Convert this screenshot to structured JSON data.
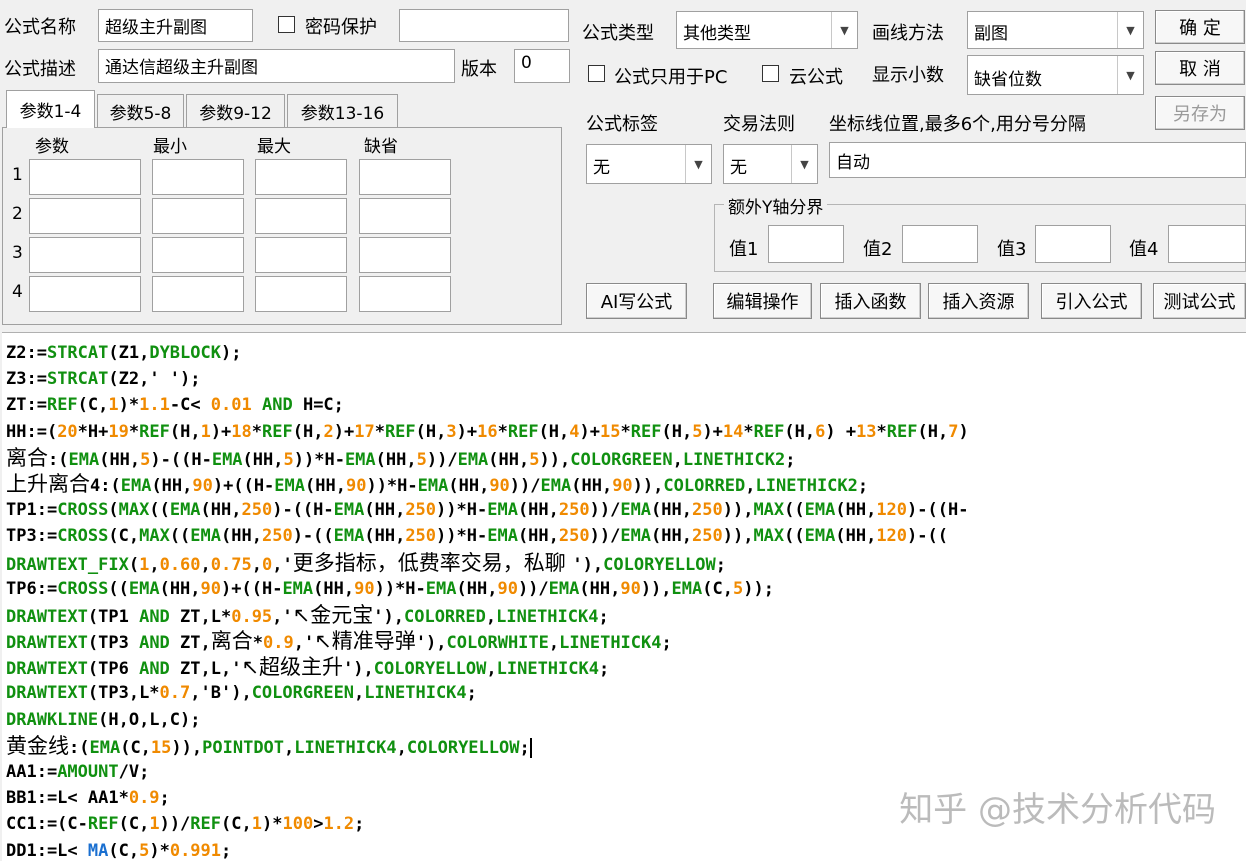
{
  "header": {
    "formula_name_label": "公式名称",
    "formula_name_value": "超级主升副图",
    "password_label": "密码保护",
    "password_value": "",
    "formula_desc_label": "公式描述",
    "formula_desc_value": "通达信超级主升副图",
    "version_label": "版本",
    "version_value": "0",
    "formula_type_label": "公式类型",
    "formula_type_value": "其他类型",
    "draw_method_label": "画线方法",
    "draw_method_value": "副图",
    "pc_only_label": "公式只用于PC",
    "cloud_label": "云公式",
    "decimals_label": "显示小数",
    "decimals_value": "缺省位数",
    "formula_tag_label": "公式标签",
    "formula_tag_value": "无",
    "trade_rule_label": "交易法则",
    "trade_rule_value": "无",
    "axis_label": "坐标线位置,最多6个,用分号分隔",
    "axis_value": "自动",
    "extra_y_label": "额外Y轴分界",
    "y1_label": "值1",
    "y2_label": "值2",
    "y3_label": "值3",
    "y4_label": "值4"
  },
  "buttons": {
    "ok": "确 定",
    "cancel": "取 消",
    "save_as": "另存为",
    "ai": "AI写公式",
    "edit": "编辑操作",
    "insert_func": "插入函数",
    "insert_res": "插入资源",
    "import": "引入公式",
    "test": "测试公式"
  },
  "tabs": [
    "参数1-4",
    "参数5-8",
    "参数9-12",
    "参数13-16"
  ],
  "params": {
    "headers": [
      "参数",
      "最小",
      "最大",
      "缺省"
    ],
    "rows": [
      "1",
      "2",
      "3",
      "4"
    ]
  },
  "code_lines": [
    [
      [
        "k",
        "Z2:="
      ],
      [
        "f",
        "STRCAT"
      ],
      [
        "k",
        "(Z1,"
      ],
      [
        "f",
        "DYBLOCK"
      ],
      [
        "k",
        ");"
      ]
    ],
    [
      [
        "k",
        "Z3:="
      ],
      [
        "f",
        "STRCAT"
      ],
      [
        "k",
        "(Z2,' ');"
      ]
    ],
    [
      [
        "k",
        "ZT:="
      ],
      [
        "f",
        "REF"
      ],
      [
        "k",
        "(C,"
      ],
      [
        "n",
        "1"
      ],
      [
        "k",
        ")*"
      ],
      [
        "n",
        "1.1"
      ],
      [
        "k",
        "-C< "
      ],
      [
        "n",
        "0.01"
      ],
      [
        "k",
        " "
      ],
      [
        "f",
        "AND"
      ],
      [
        "k",
        " H=C;"
      ]
    ],
    [
      [
        "k",
        "HH:=("
      ],
      [
        "n",
        "20"
      ],
      [
        "k",
        "*H+"
      ],
      [
        "n",
        "19"
      ],
      [
        "k",
        "*"
      ],
      [
        "f",
        "REF"
      ],
      [
        "k",
        "(H,"
      ],
      [
        "n",
        "1"
      ],
      [
        "k",
        ")+"
      ],
      [
        "n",
        "18"
      ],
      [
        "k",
        "*"
      ],
      [
        "f",
        "REF"
      ],
      [
        "k",
        "(H,"
      ],
      [
        "n",
        "2"
      ],
      [
        "k",
        ")+"
      ],
      [
        "n",
        "17"
      ],
      [
        "k",
        "*"
      ],
      [
        "f",
        "REF"
      ],
      [
        "k",
        "(H,"
      ],
      [
        "n",
        "3"
      ],
      [
        "k",
        ")+"
      ],
      [
        "n",
        "16"
      ],
      [
        "k",
        "*"
      ],
      [
        "f",
        "REF"
      ],
      [
        "k",
        "(H,"
      ],
      [
        "n",
        "4"
      ],
      [
        "k",
        ")+"
      ],
      [
        "n",
        "15"
      ],
      [
        "k",
        "*"
      ],
      [
        "f",
        "REF"
      ],
      [
        "k",
        "(H,"
      ],
      [
        "n",
        "5"
      ],
      [
        "k",
        ")+"
      ],
      [
        "n",
        "14"
      ],
      [
        "k",
        "*"
      ],
      [
        "f",
        "REF"
      ],
      [
        "k",
        "(H,"
      ],
      [
        "n",
        "6"
      ],
      [
        "k",
        ") +"
      ],
      [
        "n",
        "13"
      ],
      [
        "k",
        "*"
      ],
      [
        "f",
        "REF"
      ],
      [
        "k",
        "(H,"
      ],
      [
        "n",
        "7"
      ],
      [
        "k",
        ")"
      ]
    ],
    [
      [
        "c",
        "离合"
      ],
      [
        "k",
        ":("
      ],
      [
        "f",
        "EMA"
      ],
      [
        "k",
        "(HH,"
      ],
      [
        "n",
        "5"
      ],
      [
        "k",
        ")-((H-"
      ],
      [
        "f",
        "EMA"
      ],
      [
        "k",
        "(HH,"
      ],
      [
        "n",
        "5"
      ],
      [
        "k",
        "))*H-"
      ],
      [
        "f",
        "EMA"
      ],
      [
        "k",
        "(HH,"
      ],
      [
        "n",
        "5"
      ],
      [
        "k",
        "))/"
      ],
      [
        "f",
        "EMA"
      ],
      [
        "k",
        "(HH,"
      ],
      [
        "n",
        "5"
      ],
      [
        "k",
        ")),"
      ],
      [
        "f",
        "COLORGREEN"
      ],
      [
        "k",
        ","
      ],
      [
        "f",
        "LINETHICK2"
      ],
      [
        "k",
        ";"
      ]
    ],
    [
      [
        "c",
        "上升离合"
      ],
      [
        "k",
        "4:("
      ],
      [
        "f",
        "EMA"
      ],
      [
        "k",
        "(HH,"
      ],
      [
        "n",
        "90"
      ],
      [
        "k",
        ")+((H-"
      ],
      [
        "f",
        "EMA"
      ],
      [
        "k",
        "(HH,"
      ],
      [
        "n",
        "90"
      ],
      [
        "k",
        "))*H-"
      ],
      [
        "f",
        "EMA"
      ],
      [
        "k",
        "(HH,"
      ],
      [
        "n",
        "90"
      ],
      [
        "k",
        "))/"
      ],
      [
        "f",
        "EMA"
      ],
      [
        "k",
        "(HH,"
      ],
      [
        "n",
        "90"
      ],
      [
        "k",
        ")),"
      ],
      [
        "f",
        "COLORRED"
      ],
      [
        "k",
        ","
      ],
      [
        "f",
        "LINETHICK2"
      ],
      [
        "k",
        ";"
      ]
    ],
    [
      [
        "k",
        "TP1:="
      ],
      [
        "f",
        "CROSS"
      ],
      [
        "k",
        "("
      ],
      [
        "f",
        "MAX"
      ],
      [
        "k",
        "(("
      ],
      [
        "f",
        "EMA"
      ],
      [
        "k",
        "(HH,"
      ],
      [
        "n",
        "250"
      ],
      [
        "k",
        ")-((H-"
      ],
      [
        "f",
        "EMA"
      ],
      [
        "k",
        "(HH,"
      ],
      [
        "n",
        "250"
      ],
      [
        "k",
        "))*H-"
      ],
      [
        "f",
        "EMA"
      ],
      [
        "k",
        "(HH,"
      ],
      [
        "n",
        "250"
      ],
      [
        "k",
        "))/"
      ],
      [
        "f",
        "EMA"
      ],
      [
        "k",
        "(HH,"
      ],
      [
        "n",
        "250"
      ],
      [
        "k",
        ")),"
      ],
      [
        "f",
        "MAX"
      ],
      [
        "k",
        "(("
      ],
      [
        "f",
        "EMA"
      ],
      [
        "k",
        "(HH,"
      ],
      [
        "n",
        "120"
      ],
      [
        "k",
        ")-((H-"
      ]
    ],
    [
      [
        "k",
        "TP3:="
      ],
      [
        "f",
        "CROSS"
      ],
      [
        "k",
        "(C,"
      ],
      [
        "f",
        "MAX"
      ],
      [
        "k",
        "(("
      ],
      [
        "f",
        "EMA"
      ],
      [
        "k",
        "(HH,"
      ],
      [
        "n",
        "250"
      ],
      [
        "k",
        ")-(("
      ],
      [
        "f",
        "EMA"
      ],
      [
        "k",
        "(HH,"
      ],
      [
        "n",
        "250"
      ],
      [
        "k",
        "))*H-"
      ],
      [
        "f",
        "EMA"
      ],
      [
        "k",
        "(HH,"
      ],
      [
        "n",
        "250"
      ],
      [
        "k",
        "))/"
      ],
      [
        "f",
        "EMA"
      ],
      [
        "k",
        "(HH,"
      ],
      [
        "n",
        "250"
      ],
      [
        "k",
        ")),"
      ],
      [
        "f",
        "MAX"
      ],
      [
        "k",
        "(("
      ],
      [
        "f",
        "EMA"
      ],
      [
        "k",
        "(HH,"
      ],
      [
        "n",
        "120"
      ],
      [
        "k",
        ")-(("
      ]
    ],
    [
      [
        "f",
        "DRAWTEXT_FIX"
      ],
      [
        "k",
        "("
      ],
      [
        "n",
        "1"
      ],
      [
        "k",
        ","
      ],
      [
        "n",
        "0.60"
      ],
      [
        "k",
        ","
      ],
      [
        "n",
        "0.75"
      ],
      [
        "k",
        ","
      ],
      [
        "n",
        "0"
      ],
      [
        "k",
        ",'"
      ],
      [
        "c",
        "更多指标，低费率交易，私聊 "
      ],
      [
        "k",
        "'),"
      ],
      [
        "f",
        "COLORYELLOW"
      ],
      [
        "k",
        ";"
      ]
    ],
    [
      [
        "k",
        "TP6:="
      ],
      [
        "f",
        "CROSS"
      ],
      [
        "k",
        "(("
      ],
      [
        "f",
        "EMA"
      ],
      [
        "k",
        "(HH,"
      ],
      [
        "n",
        "90"
      ],
      [
        "k",
        ")+((H-"
      ],
      [
        "f",
        "EMA"
      ],
      [
        "k",
        "(HH,"
      ],
      [
        "n",
        "90"
      ],
      [
        "k",
        "))*H-"
      ],
      [
        "f",
        "EMA"
      ],
      [
        "k",
        "(HH,"
      ],
      [
        "n",
        "90"
      ],
      [
        "k",
        "))/"
      ],
      [
        "f",
        "EMA"
      ],
      [
        "k",
        "(HH,"
      ],
      [
        "n",
        "90"
      ],
      [
        "k",
        ")),"
      ],
      [
        "f",
        "EMA"
      ],
      [
        "k",
        "(C,"
      ],
      [
        "n",
        "5"
      ],
      [
        "k",
        "));"
      ]
    ],
    [
      [
        "f",
        "DRAWTEXT"
      ],
      [
        "k",
        "(TP1 "
      ],
      [
        "f",
        "AND"
      ],
      [
        "k",
        " ZT,L*"
      ],
      [
        "n",
        "0.95"
      ],
      [
        "k",
        ",'"
      ],
      [
        "c",
        "↖金元宝"
      ],
      [
        "k",
        "'),"
      ],
      [
        "f",
        "COLORRED"
      ],
      [
        "k",
        ","
      ],
      [
        "f",
        "LINETHICK4"
      ],
      [
        "k",
        ";"
      ]
    ],
    [
      [
        "f",
        "DRAWTEXT"
      ],
      [
        "k",
        "(TP3 "
      ],
      [
        "f",
        "AND"
      ],
      [
        "k",
        " ZT,"
      ],
      [
        "c",
        "离合"
      ],
      [
        "k",
        "*"
      ],
      [
        "n",
        "0.9"
      ],
      [
        "k",
        ",'"
      ],
      [
        "c",
        "↖精准导弹"
      ],
      [
        "k",
        "'),"
      ],
      [
        "f",
        "COLORWHITE"
      ],
      [
        "k",
        ","
      ],
      [
        "f",
        "LINETHICK4"
      ],
      [
        "k",
        ";"
      ]
    ],
    [
      [
        "f",
        "DRAWTEXT"
      ],
      [
        "k",
        "(TP6 "
      ],
      [
        "f",
        "AND"
      ],
      [
        "k",
        " ZT,L,'"
      ],
      [
        "c",
        "↖超级主升"
      ],
      [
        "k",
        "'),"
      ],
      [
        "f",
        "COLORYELLOW"
      ],
      [
        "k",
        ","
      ],
      [
        "f",
        "LINETHICK4"
      ],
      [
        "k",
        ";"
      ]
    ],
    [
      [
        "f",
        "DRAWTEXT"
      ],
      [
        "k",
        "(TP3,L*"
      ],
      [
        "n",
        "0.7"
      ],
      [
        "k",
        ",'B'),"
      ],
      [
        "f",
        "COLORGREEN"
      ],
      [
        "k",
        ","
      ],
      [
        "f",
        "LINETHICK4"
      ],
      [
        "k",
        ";"
      ]
    ],
    [
      [
        "f",
        "DRAWKLINE"
      ],
      [
        "k",
        "(H,O,L,C);"
      ]
    ],
    [
      [
        "c",
        "黄金线"
      ],
      [
        "k",
        ":("
      ],
      [
        "f",
        "EMA"
      ],
      [
        "k",
        "(C,"
      ],
      [
        "n",
        "15"
      ],
      [
        "k",
        "))"
      ],
      [
        "k",
        ","
      ],
      [
        "f",
        "POINTDOT"
      ],
      [
        "k",
        ","
      ],
      [
        "f",
        "LINETHICK4"
      ],
      [
        "k",
        ","
      ],
      [
        "f",
        "COLORYELLOW"
      ],
      [
        "k",
        ";"
      ],
      [
        "caret",
        ""
      ]
    ],
    [
      [
        "k",
        "AA1:="
      ],
      [
        "f",
        "AMOUNT"
      ],
      [
        "k",
        "/V;"
      ]
    ],
    [
      [
        "k",
        "BB1:=L< AA1*"
      ],
      [
        "n",
        "0.9"
      ],
      [
        "k",
        ";"
      ]
    ],
    [
      [
        "k",
        "CC1:=(C-"
      ],
      [
        "f",
        "REF"
      ],
      [
        "k",
        "(C,"
      ],
      [
        "n",
        "1"
      ],
      [
        "k",
        "))/"
      ],
      [
        "f",
        "REF"
      ],
      [
        "k",
        "(C,"
      ],
      [
        "n",
        "1"
      ],
      [
        "k",
        ")*"
      ],
      [
        "n",
        "100"
      ],
      [
        "k",
        ">"
      ],
      [
        "n",
        "1.2"
      ],
      [
        "k",
        ";"
      ]
    ],
    [
      [
        "k",
        "DD1:=L< "
      ],
      [
        "b",
        "MA"
      ],
      [
        "k",
        "(C,"
      ],
      [
        "n",
        "5"
      ],
      [
        "k",
        ")*"
      ],
      [
        "n",
        "0.991"
      ],
      [
        "k",
        ";"
      ]
    ]
  ],
  "watermark": "知乎 @技术分析代码"
}
